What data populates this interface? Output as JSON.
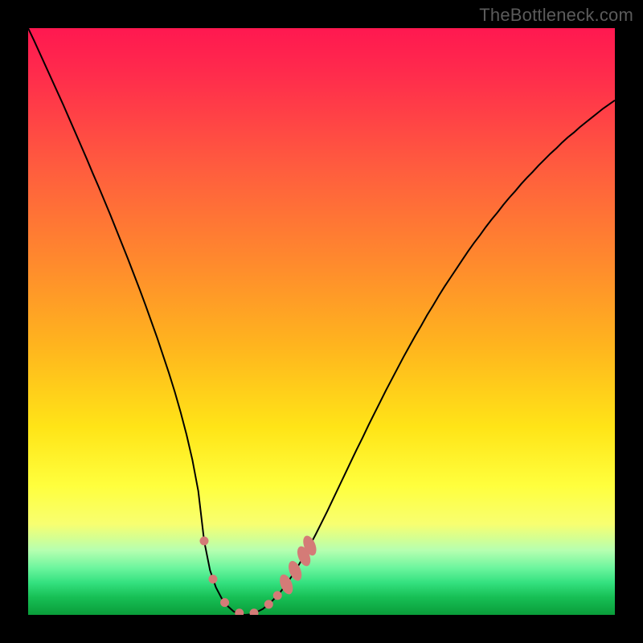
{
  "watermark": "TheBottleneck.com",
  "chart_data": {
    "type": "line",
    "title": "",
    "xlabel": "",
    "ylabel": "",
    "xlim": [
      0,
      100
    ],
    "ylim": [
      0,
      100
    ],
    "x": [
      0,
      1,
      2,
      3,
      4,
      5,
      6,
      7,
      8,
      9,
      10,
      11,
      12,
      13,
      14,
      15,
      16,
      17,
      18,
      19,
      20,
      21,
      22,
      23,
      24,
      25,
      26,
      27,
      28,
      29,
      30,
      31,
      32,
      33,
      34,
      35,
      36,
      37,
      38,
      39,
      40,
      41,
      42,
      43,
      44,
      45,
      46,
      47,
      48,
      49,
      50,
      51,
      52,
      53,
      54,
      55,
      56,
      57,
      58,
      59,
      60,
      61,
      62,
      63,
      64,
      65,
      66,
      67,
      68,
      69,
      70,
      71,
      72,
      73,
      74,
      75,
      76,
      77,
      78,
      79,
      80,
      81,
      82,
      83,
      84,
      85,
      86,
      87,
      88,
      89,
      90,
      91,
      92,
      93,
      94,
      95,
      96,
      97,
      98,
      99,
      100
    ],
    "y": [
      100.0,
      97.9,
      95.7,
      93.5,
      91.3,
      89.1,
      86.9,
      84.6,
      82.3,
      80.0,
      77.7,
      75.3,
      73.0,
      70.6,
      68.2,
      65.7,
      63.2,
      60.7,
      58.1,
      55.5,
      52.8,
      50.0,
      47.2,
      44.2,
      41.2,
      38.0,
      34.5,
      30.7,
      26.4,
      21.1,
      12.6,
      7.6,
      4.7,
      2.8,
      1.5,
      0.6,
      0.1,
      0.0,
      0.1,
      0.5,
      1.0,
      1.8,
      2.8,
      3.9,
      5.2,
      6.7,
      8.3,
      10.0,
      11.8,
      13.7,
      15.7,
      17.7,
      19.8,
      21.9,
      24.0,
      26.1,
      28.2,
      30.2,
      32.3,
      34.3,
      36.3,
      38.3,
      40.2,
      42.1,
      44.0,
      45.8,
      47.6,
      49.3,
      51.1,
      52.7,
      54.4,
      56.0,
      57.5,
      59.0,
      60.5,
      62.0,
      63.4,
      64.7,
      66.1,
      67.4,
      68.6,
      69.9,
      71.1,
      72.2,
      73.4,
      74.5,
      75.5,
      76.6,
      77.6,
      78.6,
      79.5,
      80.5,
      81.4,
      82.2,
      83.1,
      83.9,
      84.7,
      85.5,
      86.3,
      87.0,
      87.7
    ],
    "annotations": [
      {
        "x": 30.0,
        "y": 12.6,
        "type": "dot"
      },
      {
        "x": 31.5,
        "y": 6.1,
        "type": "dot"
      },
      {
        "x": 33.5,
        "y": 2.1,
        "type": "dot"
      },
      {
        "x": 36.0,
        "y": 0.3,
        "type": "dot"
      },
      {
        "x": 38.5,
        "y": 0.3,
        "type": "dot"
      },
      {
        "x": 41.0,
        "y": 1.8,
        "type": "dot"
      },
      {
        "x": 42.5,
        "y": 3.3,
        "type": "dot"
      },
      {
        "x": 44.0,
        "y": 5.2,
        "type": "blob"
      },
      {
        "x": 45.5,
        "y": 7.5,
        "type": "blob"
      },
      {
        "x": 47.0,
        "y": 10.0,
        "type": "blob"
      },
      {
        "x": 48.0,
        "y": 11.8,
        "type": "blob"
      }
    ],
    "gradient_stops": [
      {
        "pos": 0.0,
        "color": "#ff1850"
      },
      {
        "pos": 0.08,
        "color": "#ff2c4c"
      },
      {
        "pos": 0.24,
        "color": "#ff5d3e"
      },
      {
        "pos": 0.4,
        "color": "#ff8a2d"
      },
      {
        "pos": 0.54,
        "color": "#ffb41e"
      },
      {
        "pos": 0.68,
        "color": "#ffe417"
      },
      {
        "pos": 0.78,
        "color": "#ffff3d"
      },
      {
        "pos": 0.845,
        "color": "#f8ff70"
      },
      {
        "pos": 0.89,
        "color": "#b6ffb0"
      },
      {
        "pos": 0.92,
        "color": "#6cf59e"
      },
      {
        "pos": 0.945,
        "color": "#34e17f"
      },
      {
        "pos": 0.97,
        "color": "#17bf55"
      },
      {
        "pos": 1.0,
        "color": "#0a9d3a"
      }
    ],
    "annotation_color": "#d47b77",
    "curve_color": "#000000"
  }
}
